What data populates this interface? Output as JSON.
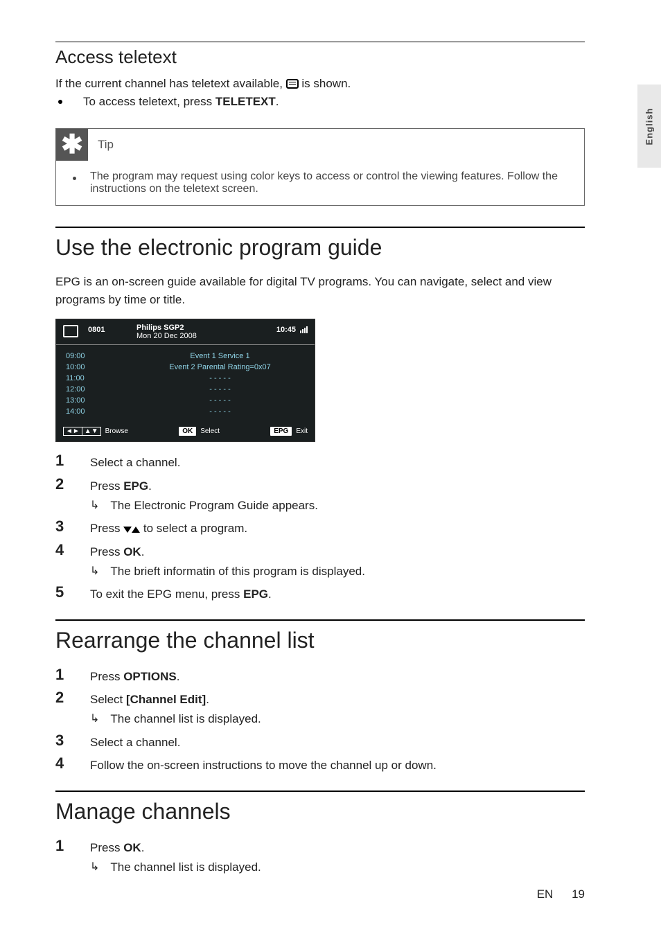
{
  "side_tab": "English",
  "access_teletext": {
    "heading": "Access teletext",
    "intro_before": "If the current channel has teletext available, ",
    "intro_after": " is shown.",
    "bullet_before": "To access teletext, press ",
    "bullet_bold": "TELETEXT",
    "bullet_after": "."
  },
  "tip": {
    "label": "Tip",
    "body": "The program may request using color keys to access or control the viewing features. Follow the instructions on the teletext screen."
  },
  "epg_section": {
    "heading": "Use the electronic program guide",
    "intro": "EPG is an on-screen guide available for digital TV programs. You can navigate, select and view programs by time or title."
  },
  "epg_screenshot": {
    "channel_num": "0801",
    "title_line1": "Philips SGP2",
    "title_line2": "Mon 20 Dec 2008",
    "clock": "10:45",
    "rows": [
      {
        "time": "09:00",
        "event": "Event 1 Service 1"
      },
      {
        "time": "10:00",
        "event": "Event 2 Parental Rating=0x07"
      },
      {
        "time": "11:00",
        "event": "- - - - -"
      },
      {
        "time": "12:00",
        "event": "- - - - -"
      },
      {
        "time": "13:00",
        "event": "- - - - -"
      },
      {
        "time": "14:00",
        "event": "- - - - -"
      }
    ],
    "foot": {
      "browse": "Browse",
      "ok": "OK",
      "select": "Select",
      "epg": "EPG",
      "exit": "Exit"
    }
  },
  "epg_steps": {
    "s1": "Select a channel.",
    "s2_pre": "Press ",
    "s2_bold": "EPG",
    "s2_post": ".",
    "s2_sub": "The Electronic Program Guide appears.",
    "s3_pre": "Press ",
    "s3_post": " to select a program.",
    "s4_pre": "Press ",
    "s4_bold": "OK",
    "s4_post": ".",
    "s4_sub": "The brieft informatin of this program is displayed.",
    "s5_pre": "To exit the EPG menu, press ",
    "s5_bold": "EPG",
    "s5_post": "."
  },
  "rearrange": {
    "heading": "Rearrange the channel list",
    "s1_pre": "Press ",
    "s1_bold": "OPTIONS",
    "s1_post": ".",
    "s2_pre": "Select ",
    "s2_bold": "[Channel Edit]",
    "s2_post": ".",
    "s2_sub": "The channel list is displayed.",
    "s3": "Select a channel.",
    "s4": "Follow the on-screen instructions to move the channel up or down."
  },
  "manage": {
    "heading": "Manage channels",
    "s1_pre": "Press ",
    "s1_bold": "OK",
    "s1_post": ".",
    "s1_sub": "The channel list is displayed."
  },
  "footer": {
    "lang": "EN",
    "page": "19"
  }
}
